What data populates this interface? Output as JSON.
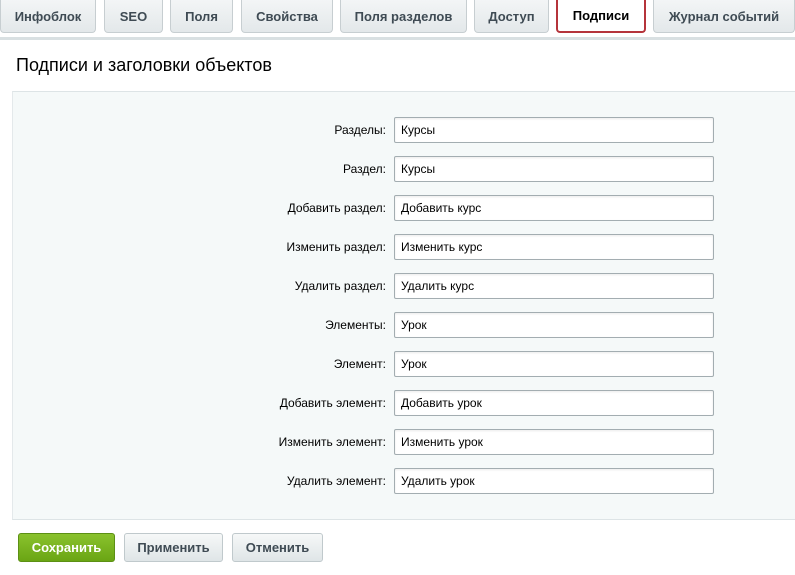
{
  "tabs": [
    {
      "label": "Инфоблок"
    },
    {
      "label": "SEO"
    },
    {
      "label": "Поля"
    },
    {
      "label": "Свойства"
    },
    {
      "label": "Поля разделов"
    },
    {
      "label": "Доступ"
    },
    {
      "label": "Подписи"
    },
    {
      "label": "Журнал событий"
    }
  ],
  "active_tab": "Подписи",
  "page": {
    "title": "Подписи и заголовки объектов"
  },
  "fields": [
    {
      "label": "Разделы:",
      "value": "Курсы"
    },
    {
      "label": "Раздел:",
      "value": "Курсы"
    },
    {
      "label": "Добавить раздел:",
      "value": "Добавить курс"
    },
    {
      "label": "Изменить раздел:",
      "value": "Изменить курс"
    },
    {
      "label": "Удалить раздел:",
      "value": "Удалить курс"
    },
    {
      "label": "Элементы:",
      "value": "Урок"
    },
    {
      "label": "Элемент:",
      "value": "Урок"
    },
    {
      "label": "Добавить элемент:",
      "value": "Добавить урок"
    },
    {
      "label": "Изменить элемент:",
      "value": "Изменить урок"
    },
    {
      "label": "Удалить элемент:",
      "value": "Удалить урок"
    }
  ],
  "buttons": {
    "save": "Сохранить",
    "apply": "Применить",
    "cancel": "Отменить"
  },
  "colors": {
    "active_tab_border": "#b5343b",
    "save_button": "#7ab421"
  }
}
